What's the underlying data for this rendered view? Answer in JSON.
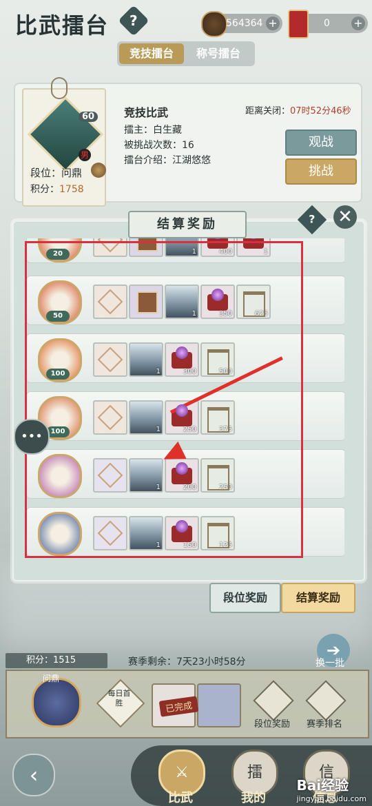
{
  "header": {
    "title": "比武擂台",
    "help_label": "?",
    "coins": "564364",
    "tickets": "0",
    "plus": "+"
  },
  "tabs": [
    {
      "label": "竞技擂台",
      "active": true
    },
    {
      "label": "称号擂台",
      "active": false
    }
  ],
  "host_card": {
    "level": "60",
    "rank_label": "段位：",
    "rank": "问鼎",
    "score_label": "积分：",
    "score": "1758",
    "arena_name": "竞技比武",
    "countdown_label": "距离关闭：",
    "countdown": "07时52分46秒",
    "host_line": "擂主：白生藏",
    "challenged_line": "被挑战次数：16",
    "intro_line": "擂台介绍：江湖悠悠",
    "watch_button": "观战",
    "challenge_button": "挑战"
  },
  "modal": {
    "title": "结算奖励",
    "help_label": "?",
    "close_label": "✕",
    "rows": [
      {
        "emblem_num": "20",
        "emblem_color": "#d7572e",
        "items": [
          {
            "type": "frame",
            "count": ""
          },
          {
            "type": "book",
            "count": ""
          },
          {
            "type": "scene",
            "count": "1"
          },
          {
            "type": "orb",
            "count": "400"
          },
          {
            "type": "orb",
            "count": "1"
          }
        ]
      },
      {
        "emblem_num": "50",
        "emblem_color": "#d7572e",
        "items": [
          {
            "type": "frame",
            "count": ""
          },
          {
            "type": "book",
            "count": ""
          },
          {
            "type": "scene",
            "count": "1"
          },
          {
            "type": "orb",
            "count": "350"
          },
          {
            "type": "stall",
            "count": "625"
          }
        ]
      },
      {
        "emblem_num": "100",
        "emblem_color": "#e06a2a",
        "items": [
          {
            "type": "frame",
            "count": ""
          },
          {
            "type": "scene",
            "count": "1"
          },
          {
            "type": "orb",
            "count": "300"
          },
          {
            "type": "stall",
            "count": "500"
          }
        ]
      },
      {
        "emblem_num": "100",
        "emblem_color": "#d96a3a",
        "items": [
          {
            "type": "frame",
            "count": ""
          },
          {
            "type": "scene",
            "count": "1"
          },
          {
            "type": "orb",
            "count": "250"
          },
          {
            "type": "stall",
            "count": "375"
          }
        ]
      },
      {
        "emblem_num": "",
        "emblem_color": "#b35aa6",
        "items": [
          {
            "type": "frame-purple",
            "count": ""
          },
          {
            "type": "scene",
            "count": "1"
          },
          {
            "type": "orb",
            "count": "200"
          },
          {
            "type": "stall",
            "count": "250"
          }
        ]
      },
      {
        "emblem_num": "",
        "emblem_color": "#3f5c9a",
        "items": [
          {
            "type": "frame-purple",
            "count": ""
          },
          {
            "type": "scene",
            "count": "1"
          },
          {
            "type": "orb",
            "count": "150"
          },
          {
            "type": "stall",
            "count": "125"
          }
        ]
      }
    ]
  },
  "reward_tabs": {
    "rank_reward": "段位奖励",
    "settle_reward": "结算奖励"
  },
  "bottom": {
    "score_label": "积分：",
    "score": "1515",
    "season_label": "赛季剩余：",
    "season_remaining": "7天23小时58分",
    "refresh_label": "换一批",
    "emblem_label": "问鼎",
    "daily_first_win": "每日首胜",
    "done_stamp": "已完成",
    "rank_reward_btn": "段位奖励",
    "season_rank_btn": "赛季排名"
  },
  "nav": {
    "back": "‹",
    "items": [
      {
        "label": "比武",
        "active": true
      },
      {
        "label": "我的",
        "active": false
      },
      {
        "label": "信息",
        "active": false
      }
    ]
  },
  "watermark": {
    "brand": "Bai经验",
    "url": "jingyan.baidu.com"
  },
  "colors": {
    "highlight_box": "#d8313d",
    "arrow": "#e0302a",
    "active_tab": "#b99a57"
  }
}
